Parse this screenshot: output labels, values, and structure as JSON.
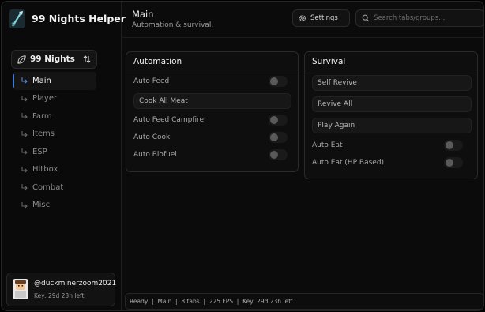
{
  "app": {
    "title": "99 Nights Helper"
  },
  "game_selector": {
    "label": "99 Nights"
  },
  "nav": {
    "items": [
      {
        "label": "Main",
        "active": true
      },
      {
        "label": "Player"
      },
      {
        "label": "Farm"
      },
      {
        "label": "Items"
      },
      {
        "label": "ESP"
      },
      {
        "label": "Hitbox"
      },
      {
        "label": "Combat"
      },
      {
        "label": "Misc"
      }
    ]
  },
  "user": {
    "name": "@duckminerzoom2021",
    "key": "Key: 29d 23h left"
  },
  "header": {
    "title": "Main",
    "subtitle": "Automation & survival.",
    "settings_label": "Settings",
    "search_placeholder": "Search tabs/groups..."
  },
  "automation": {
    "title": "Automation",
    "auto_feed": "Auto Feed",
    "cook_all_meat": "Cook All Meat",
    "auto_feed_campfire": "Auto Feed Campfire",
    "auto_cook": "Auto Cook",
    "auto_biofuel": "Auto Biofuel"
  },
  "survival": {
    "title": "Survival",
    "self_revive": "Self Revive",
    "revive_all": "Revive All",
    "play_again": "Play Again",
    "auto_eat": "Auto Eat",
    "auto_eat_hp": "Auto Eat (HP Based)"
  },
  "toggles": {
    "auto_feed": false,
    "auto_feed_campfire": false,
    "auto_cook": false,
    "auto_biofuel": false,
    "auto_eat": false,
    "auto_eat_hp": false
  },
  "status": {
    "text": "Ready  |  Main  |  8 tabs  |  225 FPS  |  Key: 29d 23h left"
  },
  "colors": {
    "accent": "#3f7bd9",
    "background": "#0b0b0b",
    "panel": "#0e0e0e"
  },
  "icons": {
    "logo": "spear-logo-icon",
    "game": "leaf-icon",
    "swap": "swap-arrows-icon",
    "nav_arrow": "return-arrow-icon",
    "settings": "gear-icon",
    "search": "search-icon"
  }
}
